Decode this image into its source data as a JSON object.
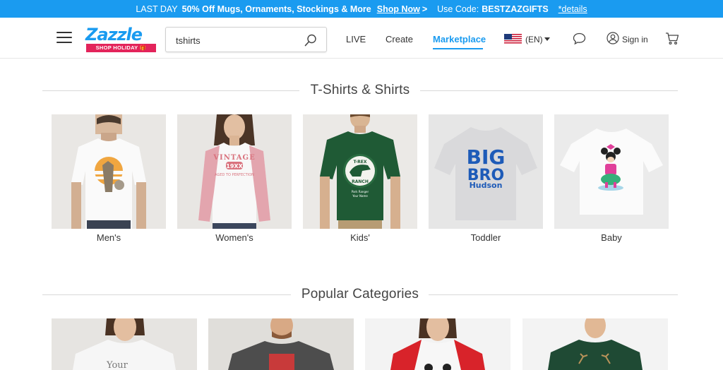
{
  "promo": {
    "last_day": "LAST DAY",
    "offer": "50% Off Mugs, Ornaments, Stockings & More",
    "shop_now": "Shop Now",
    "arrow": ">",
    "code_label": "Use Code:",
    "code": "BESTZAZGIFTS",
    "details": "*details"
  },
  "header": {
    "logo_text": "Zazzle",
    "logo_badge": "SHOP HOLIDAY 🎁",
    "search_value": "tshirts",
    "nav": {
      "live": "LIVE",
      "create": "Create",
      "marketplace": "Marketplace"
    },
    "language": "(EN)",
    "sign_in": "Sign in"
  },
  "sections": {
    "tshirts_title": "T-Shirts & Shirts",
    "popular_title": "Popular Categories"
  },
  "categories": [
    {
      "label": "Men's"
    },
    {
      "label": "Women's"
    },
    {
      "label": "Kids'"
    },
    {
      "label": "Toddler"
    },
    {
      "label": "Baby"
    }
  ],
  "product_art": {
    "womens_line1": "VINTAGE",
    "womens_line2": "19XX",
    "womens_line3": "AGED TO PERFECTION",
    "kids_line1": "T-REX",
    "kids_line2": "RANCH",
    "kids_line3": "Park Ranger",
    "kids_line4": "Your Name",
    "toddler_line1": "BIG",
    "toddler_line2": "BRO",
    "toddler_line3": "Hudson",
    "popular1_text": "Your"
  },
  "colors": {
    "accent": "#1a9bf0",
    "badge": "#e3245b",
    "promo_bg": "#1a9bf0"
  }
}
